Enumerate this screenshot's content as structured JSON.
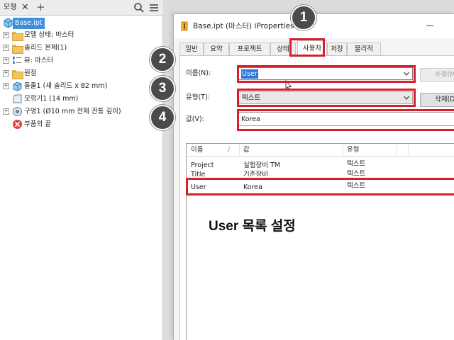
{
  "browser": {
    "tab_label": "모형",
    "tab_close": "✕",
    "tab_add": "+",
    "icons": [
      "search-icon",
      "menu-icon"
    ],
    "tree": [
      {
        "label": "Base.ipt",
        "icon": "part-file-icon",
        "expander": "",
        "selected": true
      },
      {
        "label": "모델 상태: 마스터",
        "icon": "folder-icon",
        "expander": "+"
      },
      {
        "label": "솔리드 본체(1)",
        "icon": "folder-icon",
        "expander": "+"
      },
      {
        "label": "뷰: 마스터",
        "icon": "view-icon",
        "expander": "+"
      },
      {
        "label": "원점",
        "icon": "folder-icon",
        "expander": "+"
      },
      {
        "label": "돌출1 (새 솔리드 x 82 mm)",
        "icon": "extrude-icon",
        "expander": "+"
      },
      {
        "label": "모깎기1 (14 mm)",
        "icon": "fillet-icon",
        "expander": ""
      },
      {
        "label": "구멍1 (Ø10 mm 전체 관통 깊이)",
        "icon": "hole-icon",
        "expander": "+"
      },
      {
        "label": "부품의 끝",
        "icon": "end-of-part-icon",
        "expander": ""
      }
    ]
  },
  "dialog": {
    "title": "Base.ipt (마스터) iProperties",
    "tabs": [
      "일반",
      "요약",
      "프로젝트",
      "상태",
      "사용자",
      "저장",
      "물리적"
    ],
    "active_tab": "사용자",
    "name_label": "이름(N):",
    "name_value": "User",
    "type_label": "유형(T):",
    "type_value": "텍스트",
    "value_label": "값(V):",
    "value_value": "Korea",
    "modify_button": "수정(M)",
    "delete_button": "삭제(D)",
    "list_headers": [
      "이름",
      "값",
      "유형"
    ],
    "list_rows": [
      {
        "name": "Project",
        "value": "실험장비 TM",
        "type": "텍스트"
      },
      {
        "name": "Title",
        "value": "기준장비",
        "type": "텍스트"
      },
      {
        "name": "User",
        "value": "Korea",
        "type": "텍스트"
      }
    ]
  },
  "callouts": [
    "1",
    "2",
    "3",
    "4"
  ],
  "caption": "User 목록 설정",
  "colors": {
    "highlight_red": "#d71e2b",
    "selection_blue": "#2f72d6",
    "badge_grey": "#4b4b4b"
  }
}
